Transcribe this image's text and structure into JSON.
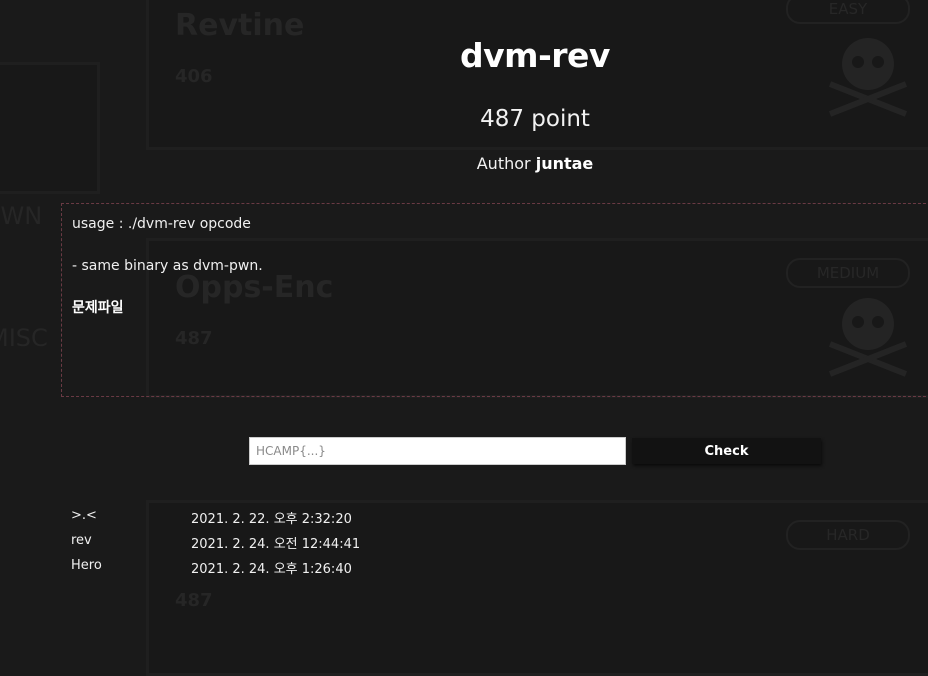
{
  "background": {
    "cards": [
      {
        "name": "Revtine",
        "points": "406",
        "difficulty": "EASY"
      },
      {
        "name": "Opps-Enc",
        "points": "487",
        "difficulty": "MEDIUM"
      },
      {
        "name": "",
        "points": "487",
        "difficulty": "HARD"
      }
    ],
    "side_labels": [
      "PWN",
      "MISC"
    ]
  },
  "challenge": {
    "title": "dvm-rev",
    "points": "487 point",
    "author_label": "Author",
    "author_name": "juntae",
    "description": [
      "usage : ./dvm-rev opcode",
      "- same binary as dvm-pwn."
    ],
    "file_link": "문제파일"
  },
  "submit": {
    "placeholder": "HCAMP{...}",
    "value": "",
    "button_label": "Check"
  },
  "solvers": [
    {
      "name": ">.<",
      "time": "2021. 2. 22. 오후 2:32:20"
    },
    {
      "name": "rev",
      "time": "2021. 2. 24. 오전 12:44:41"
    },
    {
      "name": "Hero",
      "time": "2021. 2. 24. 오후 1:26:40"
    }
  ],
  "colors": {
    "background": "#1a1a1a",
    "description_border": "#6a3a44",
    "button_bg": "#121212",
    "text": "#ffffff"
  }
}
